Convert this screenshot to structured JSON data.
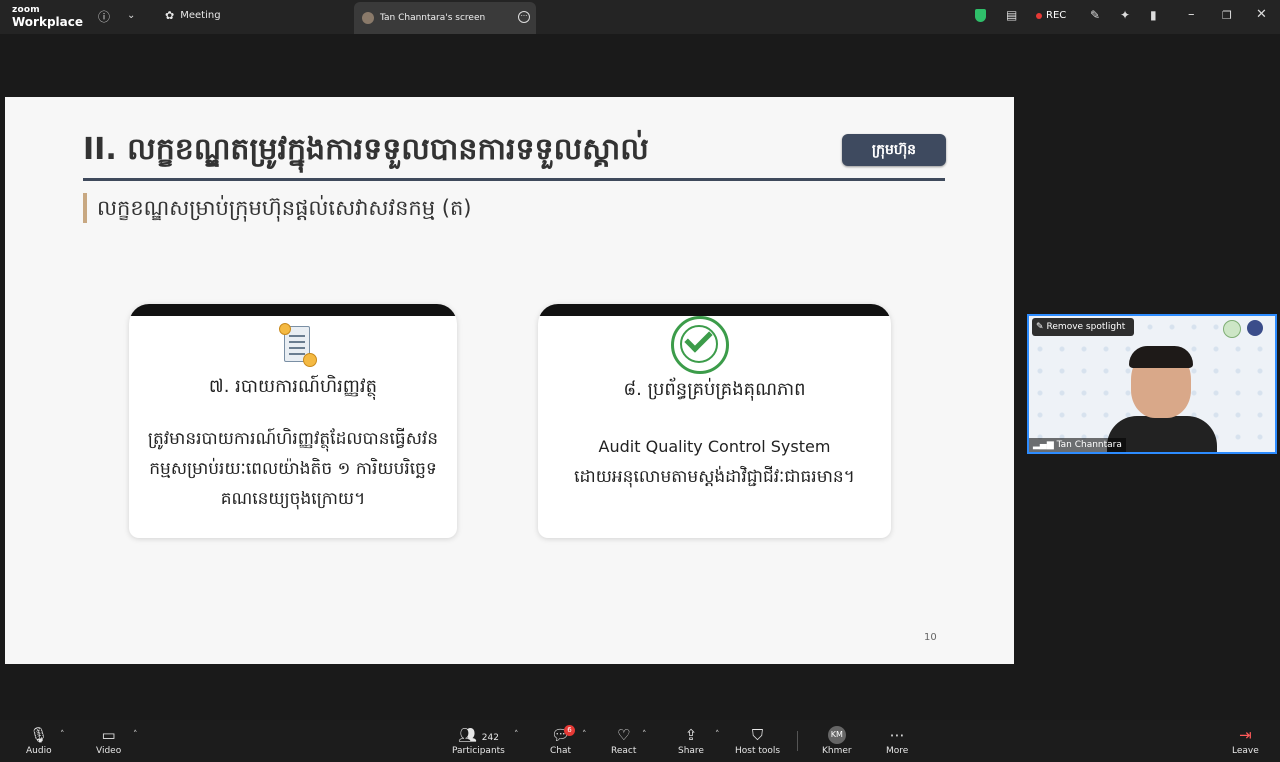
{
  "app": {
    "logo_line1": "zoom",
    "logo_line2": "Workplace"
  },
  "topbar": {
    "meeting_label": "Meeting",
    "screen_tab_label": "Tan Channtara's screen",
    "rec_label": "REC"
  },
  "slide": {
    "title": "II.  លក្ខខណ្ឌតម្រូវក្នុងការទទួលបានការទទួលស្គាល់",
    "badge": "ក្រុមហ៊ុន",
    "subtitle": "លក្ខខណ្ឌសម្រាប់ក្រុមហ៊ុនផ្ដល់សេវាសវនកម្ម (ត)",
    "cards": [
      {
        "icon": "financial-report-icon",
        "title": "៧. របាយការណ៍ហិរញ្ញវត្ថុ",
        "body_lines": [
          "ត្រូវមានរបាយការណ៍ហិរញ្ញវត្ថុដែលបានធ្វើសវន",
          "កម្មសម្រាប់រយៈពេលយ៉ាងតិច ១ ការិយបរិច្ឆេទ",
          "គណនេយ្យចុងក្រោយ។"
        ]
      },
      {
        "icon": "quality-control-icon",
        "title": "៨. ប្រព័ន្ធគ្រប់គ្រងគុណភាព",
        "body_lines": [
          "Audit Quality Control System",
          "ដោយអនុលោមតាមស្តង់ដាវិជ្ជាជីវៈជាធរមាន។"
        ]
      }
    ],
    "page_number": "10"
  },
  "video": {
    "remove_spotlight_label": "Remove spotlight",
    "participant_name": "Tan Channtara"
  },
  "toolbar": {
    "audio": "Audio",
    "video": "Video",
    "participants": "Participants",
    "participants_count": "242",
    "chat": "Chat",
    "chat_badge": "6",
    "react": "React",
    "share": "Share",
    "host_tools": "Host tools",
    "language_initials": "KM",
    "language": "Khmer",
    "more": "More",
    "leave": "Leave"
  }
}
